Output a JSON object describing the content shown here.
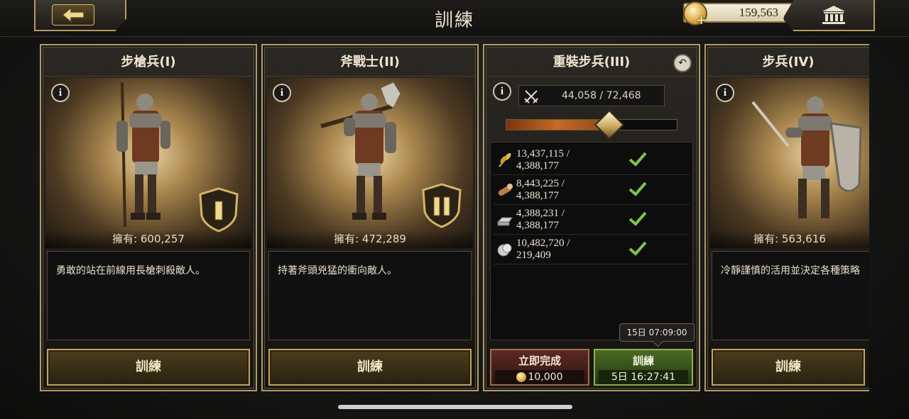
{
  "header": {
    "title": "訓練",
    "gold": "159,563",
    "back_icon": "arrow-left-icon",
    "bank_icon": "bank-icon",
    "coin_add_icon": "coin-plus-icon"
  },
  "units": [
    {
      "name": "步槍兵(I)",
      "owned": "擁有: 600,257",
      "description": "勇敢的站在前線用長槍刺殺敵人。",
      "train_label": "訓練",
      "tier": "I"
    },
    {
      "name": "斧戰士(II)",
      "owned": "擁有: 472,289",
      "description": "持著斧頭兇猛的衝向敵人。",
      "train_label": "訓練",
      "tier": "II"
    },
    {
      "name": "重裝步兵(III)",
      "troop_count": "44,058 / 72,468",
      "slider_fraction": 0.6,
      "resources": [
        {
          "icon": "wheat-icon",
          "line1": "13,437,115 /",
          "line2": "4,388,177",
          "met": true
        },
        {
          "icon": "wood-log-icon",
          "line1": "8,443,225 /",
          "line2": "4,388,177",
          "met": true
        },
        {
          "icon": "iron-ingot-icon",
          "line1": "4,388,231 /",
          "line2": "4,388,177",
          "met": true
        },
        {
          "icon": "silver-coin-icon",
          "line1": "10,482,720 /",
          "line2": "219,409",
          "met": true
        }
      ],
      "tooltip_time": "15日 07:09:00",
      "instant_label": "立即完成",
      "instant_cost": "10,000",
      "train_label": "訓練",
      "train_time": "5日 16:27:41"
    },
    {
      "name": "步兵(IV)",
      "owned": "擁有: 563,616",
      "description": "冷靜謹慎的活用並決定各種策略",
      "train_label": "訓練"
    }
  ],
  "colors": {
    "accent_gold": "#c6a35a",
    "check_green": "#7ec34a",
    "train_green": "#4b6b24",
    "instant_red": "#5a2a22"
  }
}
